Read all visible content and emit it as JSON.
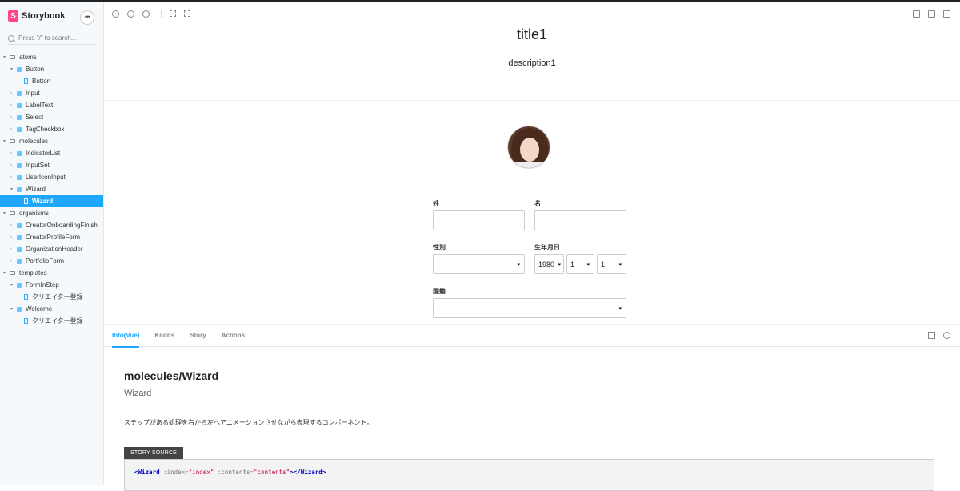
{
  "brand": {
    "name": "Storybook",
    "logo_letter": "S"
  },
  "search": {
    "placeholder": "Press \"/\" to search..."
  },
  "sidebar": {
    "items": [
      {
        "label": "atoms",
        "depth": 0,
        "type": "folder",
        "caret": "▾"
      },
      {
        "label": "Button",
        "depth": 1,
        "type": "component",
        "caret": "▾"
      },
      {
        "label": "Button",
        "depth": 2,
        "type": "story",
        "caret": ""
      },
      {
        "label": "Input",
        "depth": 1,
        "type": "component",
        "caret": "›"
      },
      {
        "label": "LabelText",
        "depth": 1,
        "type": "component",
        "caret": "›"
      },
      {
        "label": "Select",
        "depth": 1,
        "type": "component",
        "caret": "›"
      },
      {
        "label": "TagCheckbox",
        "depth": 1,
        "type": "component",
        "caret": "›"
      },
      {
        "label": "molecules",
        "depth": 0,
        "type": "folder",
        "caret": "▾"
      },
      {
        "label": "IndicatorList",
        "depth": 1,
        "type": "component",
        "caret": "›"
      },
      {
        "label": "InputSet",
        "depth": 1,
        "type": "component",
        "caret": "›"
      },
      {
        "label": "UserIconInput",
        "depth": 1,
        "type": "component",
        "caret": "›"
      },
      {
        "label": "Wizard",
        "depth": 1,
        "type": "component",
        "caret": "▾"
      },
      {
        "label": "Wizard",
        "depth": 2,
        "type": "story",
        "caret": "",
        "selected": true
      },
      {
        "label": "organisms",
        "depth": 0,
        "type": "folder",
        "caret": "▾"
      },
      {
        "label": "CreatorOnboardingFinish",
        "depth": 1,
        "type": "component",
        "caret": "›"
      },
      {
        "label": "CreatorProfileForm",
        "depth": 1,
        "type": "component",
        "caret": "›"
      },
      {
        "label": "OrganizationHeader",
        "depth": 1,
        "type": "component",
        "caret": "›"
      },
      {
        "label": "PortfolioForm",
        "depth": 1,
        "type": "component",
        "caret": "›"
      },
      {
        "label": "templates",
        "depth": 0,
        "type": "folder",
        "caret": "▾"
      },
      {
        "label": "FormInStep",
        "depth": 1,
        "type": "component",
        "caret": "▾"
      },
      {
        "label": "クリエイター登録",
        "depth": 2,
        "type": "story",
        "caret": ""
      },
      {
        "label": "Welcome",
        "depth": 1,
        "type": "component",
        "caret": "▾"
      },
      {
        "label": "クリエイター登録",
        "depth": 2,
        "type": "story",
        "caret": ""
      }
    ]
  },
  "preview": {
    "title": "title1",
    "description": "description1",
    "form": {
      "last_name_label": "姓",
      "first_name_label": "名",
      "gender_label": "性別",
      "birthdate_label": "生年月日",
      "birth_year": "1980",
      "birth_month": "1",
      "birth_day": "1",
      "nationality_label": "国籍",
      "arrow": "▾"
    }
  },
  "panel": {
    "tabs": [
      "Info(Vue)",
      "Knobs",
      "Story",
      "Actions"
    ],
    "active_tab": 0,
    "info_title": "molecules/Wizard",
    "info_subtitle": "Wizard",
    "info_description": "ステップがある処理を右から左へアニメーションさせながら表現するコンポーネント。",
    "source_label": "STORY SOURCE",
    "source": {
      "open": "<Wizard",
      "attr1": ":index=",
      "val1": "\"index\"",
      "attr2": ":contents=",
      "val2": "\"contents\"",
      "close": "></Wizard>"
    }
  }
}
